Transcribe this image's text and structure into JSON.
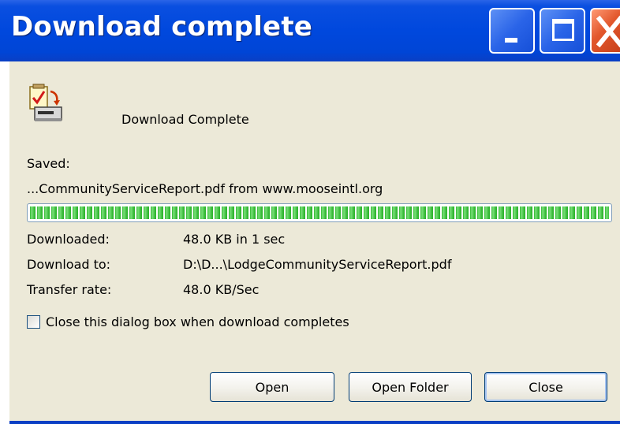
{
  "window": {
    "title": "Download complete",
    "controls": {
      "minimize": "minimize-icon",
      "maximize": "maximize-icon",
      "close": "close-icon"
    },
    "colors": {
      "titlebar": "#0048dd",
      "client": "#ece9d8",
      "close_button": "#e2572c"
    }
  },
  "header": {
    "icon": "download-complete-icon",
    "message": "Download Complete"
  },
  "saved": {
    "label": "Saved:",
    "detail": "...CommunityServiceReport.pdf from www.mooseintl.org"
  },
  "progress": {
    "percent": 100,
    "color": "#2fb52f"
  },
  "details": {
    "downloaded_label": "Downloaded:",
    "downloaded_value": "48.0 KB in 1 sec",
    "download_to_label": "Download to:",
    "download_to_value": "D:\\D...\\LodgeCommunityServiceReport.pdf",
    "transfer_rate_label": "Transfer rate:",
    "transfer_rate_value": "48.0 KB/Sec"
  },
  "options": {
    "autoclose_label": "Close this dialog box when download completes",
    "autoclose_checked": false
  },
  "buttons": {
    "open": "Open",
    "open_folder": "Open Folder",
    "close": "Close"
  }
}
